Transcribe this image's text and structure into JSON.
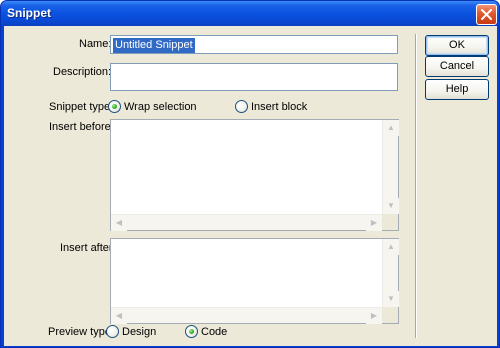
{
  "window": {
    "title": "Snippet"
  },
  "form": {
    "name_label": "Name:",
    "name_value": "Untitled Snippet",
    "description_label": "Description:",
    "description_value": "",
    "snippet_type_label": "Snippet type:",
    "snippet_type_options": [
      {
        "label": "Wrap selection",
        "selected": true
      },
      {
        "label": "Insert block",
        "selected": false
      }
    ],
    "insert_before_label": "Insert before:",
    "insert_after_label": "Insert after:",
    "preview_type_label": "Preview type:",
    "preview_type_options": [
      {
        "label": "Design",
        "selected": false
      },
      {
        "label": "Code",
        "selected": true
      }
    ]
  },
  "buttons": {
    "ok": "OK",
    "cancel": "Cancel",
    "help": "Help"
  },
  "icons": {
    "close": "close-icon",
    "arrow_up": "arrow-up-icon",
    "arrow_down": "arrow-down-icon",
    "arrow_left": "arrow-left-icon",
    "arrow_right": "arrow-right-icon"
  },
  "colors": {
    "titlebar": "#0b52e0",
    "dialog_bg": "#ece9d8",
    "selection": "#316ac5",
    "close_button": "#e0582f"
  }
}
